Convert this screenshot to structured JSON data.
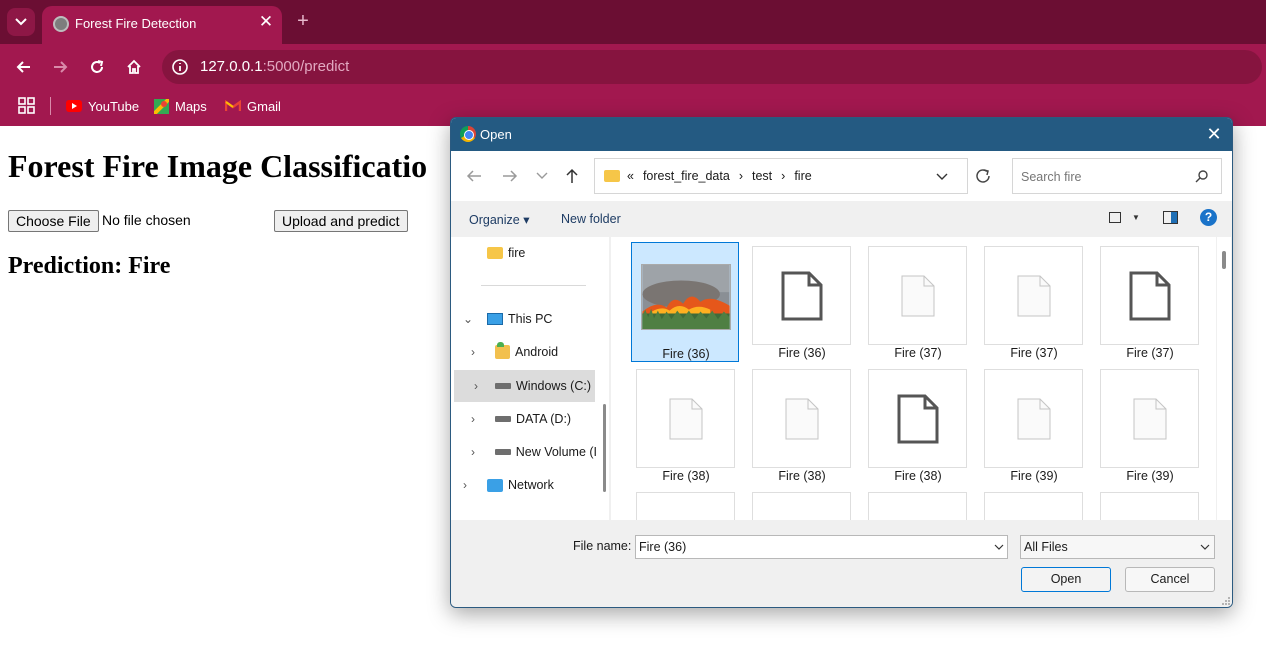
{
  "browser": {
    "tab_title": "Forest Fire Detection",
    "url_host": "127.0.0.1",
    "url_rest": ":5000/predict",
    "bookmarks": [
      "YouTube",
      "Maps",
      "Gmail"
    ],
    "colors": {
      "frame": "#6b0e33",
      "toolbar": "#a2184f"
    }
  },
  "page": {
    "title": "Forest Fire Image Classificatio",
    "choose_file_label": "Choose File",
    "no_file_text": "No file chosen",
    "upload_label": "Upload and predict",
    "prediction": "Prediction: Fire"
  },
  "dialog": {
    "title": "Open",
    "breadcrumb": [
      "«",
      "forest_fire_data",
      "›",
      "test",
      "›",
      "fire"
    ],
    "search_placeholder": "Search fire",
    "organize": "Organize ▾",
    "new_folder": "New folder",
    "nav": [
      "fire",
      "This PC",
      "Android",
      "Windows (C:)",
      "DATA (D:)",
      "New Volume (I",
      "Network"
    ],
    "files": [
      "Fire (36)",
      "Fire (36)",
      "Fire (37)",
      "Fire (37)",
      "Fire (37)",
      "Fire (38)",
      "Fire (38)",
      "Fire (38)",
      "Fire (39)",
      "Fire (39)"
    ],
    "file_name_label": "File name:",
    "file_name_value": "Fire (36)",
    "file_type_value": "All Files",
    "open_label": "Open",
    "cancel_label": "Cancel",
    "colors": {
      "titlebar": "#245a82",
      "selection": "#cce8ff",
      "accent": "#0078d7"
    }
  }
}
